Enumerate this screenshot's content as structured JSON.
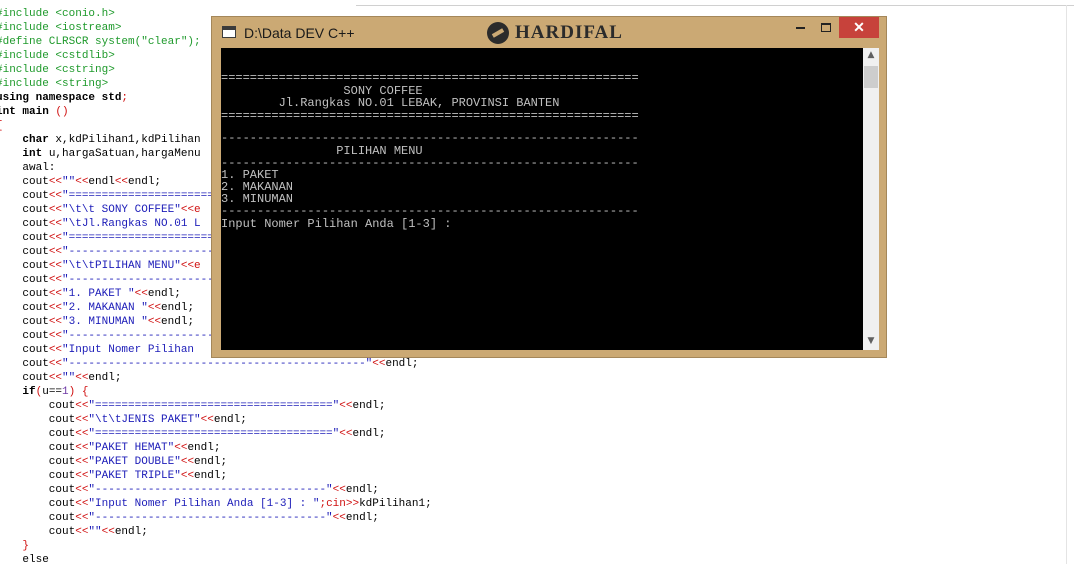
{
  "editor": {
    "lines": [
      [
        {
          "t": "#include <conio.h>",
          "c": "pp"
        }
      ],
      [
        {
          "t": "#include <iostream>",
          "c": "pp"
        }
      ],
      [
        {
          "t": "#define CLRSCR system(\"clear\");",
          "c": "pp"
        }
      ],
      [
        {
          "t": "#include <cstdlib>",
          "c": "pp"
        }
      ],
      [
        {
          "t": "#include <cstring>",
          "c": "pp"
        }
      ],
      [
        {
          "t": "#include <string>",
          "c": "pp"
        }
      ],
      [
        {
          "t": "using namespace std",
          "c": "kw"
        },
        {
          "t": ";",
          "c": "op"
        }
      ],
      [
        {
          "t": "int main ",
          "c": "kw"
        },
        {
          "t": "()",
          "c": "op"
        }
      ],
      [
        {
          "t": "{",
          "c": "op"
        }
      ],
      [
        {
          "t": "    "
        },
        {
          "t": "char",
          "c": "kw"
        },
        {
          "t": " x,kdPilihan1,kdPilihan"
        }
      ],
      [
        {
          "t": "    "
        },
        {
          "t": "int",
          "c": "kw"
        },
        {
          "t": " u,hargaSatuan,hargaMenu"
        }
      ],
      [
        {
          "t": "    awal:"
        }
      ],
      [
        {
          "t": "    cout"
        },
        {
          "t": "<<",
          "c": "op"
        },
        {
          "t": "\"\"",
          "c": "st"
        },
        {
          "t": "<<",
          "c": "op"
        },
        {
          "t": "endl"
        },
        {
          "t": "<<",
          "c": "op"
        },
        {
          "t": "endl;"
        }
      ],
      [
        {
          "t": "    cout"
        },
        {
          "t": "<<",
          "c": "op"
        },
        {
          "t": "\"==============================",
          "c": "st"
        }
      ],
      [
        {
          "t": "    cout"
        },
        {
          "t": "<<",
          "c": "op"
        },
        {
          "t": "\"\\t\\t SONY COFFEE\"",
          "c": "st"
        },
        {
          "t": "<<e",
          "c": "op"
        }
      ],
      [
        {
          "t": "    cout"
        },
        {
          "t": "<<",
          "c": "op"
        },
        {
          "t": "\"\\tJl.Rangkas NO.01 L",
          "c": "st"
        }
      ],
      [
        {
          "t": "    cout"
        },
        {
          "t": "<<",
          "c": "op"
        },
        {
          "t": "\"==============================",
          "c": "st"
        }
      ],
      [
        {
          "t": "    cout"
        },
        {
          "t": "<<",
          "c": "op"
        },
        {
          "t": "\"------------------------------",
          "c": "st"
        }
      ],
      [
        {
          "t": "    cout"
        },
        {
          "t": "<<",
          "c": "op"
        },
        {
          "t": "\"\\t\\tPILIHAN MENU\"",
          "c": "st"
        },
        {
          "t": "<<e",
          "c": "op"
        }
      ],
      [
        {
          "t": "    cout"
        },
        {
          "t": "<<",
          "c": "op"
        },
        {
          "t": "\"------------------------------",
          "c": "st"
        }
      ],
      [
        {
          "t": "    cout"
        },
        {
          "t": "<<",
          "c": "op"
        },
        {
          "t": "\"1. PAKET \"",
          "c": "st"
        },
        {
          "t": "<<",
          "c": "op"
        },
        {
          "t": "endl;"
        }
      ],
      [
        {
          "t": "    cout"
        },
        {
          "t": "<<",
          "c": "op"
        },
        {
          "t": "\"2. MAKANAN \"",
          "c": "st"
        },
        {
          "t": "<<",
          "c": "op"
        },
        {
          "t": "endl;"
        }
      ],
      [
        {
          "t": "    cout"
        },
        {
          "t": "<<",
          "c": "op"
        },
        {
          "t": "\"3. MINUMAN \"",
          "c": "st"
        },
        {
          "t": "<<",
          "c": "op"
        },
        {
          "t": "endl;"
        }
      ],
      [
        {
          "t": "    cout"
        },
        {
          "t": "<<",
          "c": "op"
        },
        {
          "t": "\"------------------------------",
          "c": "st"
        }
      ],
      [
        {
          "t": "    cout"
        },
        {
          "t": "<<",
          "c": "op"
        },
        {
          "t": "\"Input Nomer Pilihan ",
          "c": "st"
        }
      ],
      [
        {
          "t": "    cout"
        },
        {
          "t": "<<",
          "c": "op"
        },
        {
          "t": "\"---------------------------------------------\"",
          "c": "st"
        },
        {
          "t": "<<",
          "c": "op"
        },
        {
          "t": "endl;"
        }
      ],
      [
        {
          "t": "    cout"
        },
        {
          "t": "<<",
          "c": "op"
        },
        {
          "t": "\"\"",
          "c": "st"
        },
        {
          "t": "<<",
          "c": "op"
        },
        {
          "t": "endl;"
        }
      ],
      [
        {
          "t": "    "
        },
        {
          "t": "if",
          "c": "kw"
        },
        {
          "t": "(",
          "c": "op"
        },
        {
          "t": "u=="
        },
        {
          "t": "1",
          "c": "nm"
        },
        {
          "t": ") {",
          "c": "op"
        }
      ],
      [
        {
          "t": "        cout"
        },
        {
          "t": "<<",
          "c": "op"
        },
        {
          "t": "\"====================================\"",
          "c": "st"
        },
        {
          "t": "<<",
          "c": "op"
        },
        {
          "t": "endl;"
        }
      ],
      [
        {
          "t": "        cout"
        },
        {
          "t": "<<",
          "c": "op"
        },
        {
          "t": "\"\\t\\tJENIS PAKET\"",
          "c": "st"
        },
        {
          "t": "<<",
          "c": "op"
        },
        {
          "t": "endl;"
        }
      ],
      [
        {
          "t": "        cout"
        },
        {
          "t": "<<",
          "c": "op"
        },
        {
          "t": "\"====================================\"",
          "c": "st"
        },
        {
          "t": "<<",
          "c": "op"
        },
        {
          "t": "endl;"
        }
      ],
      [
        {
          "t": "        cout"
        },
        {
          "t": "<<",
          "c": "op"
        },
        {
          "t": "\"PAKET HEMAT\"",
          "c": "st"
        },
        {
          "t": "<<",
          "c": "op"
        },
        {
          "t": "endl;"
        }
      ],
      [
        {
          "t": "        cout"
        },
        {
          "t": "<<",
          "c": "op"
        },
        {
          "t": "\"PAKET DOUBLE\"",
          "c": "st"
        },
        {
          "t": "<<",
          "c": "op"
        },
        {
          "t": "endl;"
        }
      ],
      [
        {
          "t": "        cout"
        },
        {
          "t": "<<",
          "c": "op"
        },
        {
          "t": "\"PAKET TRIPLE\"",
          "c": "st"
        },
        {
          "t": "<<",
          "c": "op"
        },
        {
          "t": "endl;"
        }
      ],
      [
        {
          "t": "        cout"
        },
        {
          "t": "<<",
          "c": "op"
        },
        {
          "t": "\"-----------------------------------\"",
          "c": "st"
        },
        {
          "t": "<<",
          "c": "op"
        },
        {
          "t": "endl;"
        }
      ],
      [
        {
          "t": "        cout"
        },
        {
          "t": "<<",
          "c": "op"
        },
        {
          "t": "\"Input Nomer Pilihan Anda [1-3] : \"",
          "c": "st"
        },
        {
          "t": ";cin>>",
          "c": "op"
        },
        {
          "t": "kdPilihan1;"
        }
      ],
      [
        {
          "t": "        cout"
        },
        {
          "t": "<<",
          "c": "op"
        },
        {
          "t": "\"-----------------------------------\"",
          "c": "st"
        },
        {
          "t": "<<",
          "c": "op"
        },
        {
          "t": "endl;"
        }
      ],
      [
        {
          "t": "        cout"
        },
        {
          "t": "<<",
          "c": "op"
        },
        {
          "t": "\"\"",
          "c": "st"
        },
        {
          "t": "<<",
          "c": "op"
        },
        {
          "t": "endl;"
        }
      ],
      [
        {
          "t": "    "
        },
        {
          "t": "}",
          "c": "op"
        }
      ],
      [
        {
          "t": "    else"
        }
      ]
    ]
  },
  "console": {
    "title": "D:\\Data DEV C++",
    "brand": "HARDIFAL",
    "close_label": "✕",
    "lines": [
      "==========================================================",
      "                 SONY COFFEE",
      "        Jl.Rangkas NO.01 LEBAK, PROVINSI BANTEN",
      "==========================================================",
      "----------------------------------------------------------",
      "                PILIHAN MENU",
      "----------------------------------------------------------",
      "1. PAKET",
      "2. MAKANAN",
      "3. MINUMAN",
      "----------------------------------------------------------",
      "Input Nomer Pilihan Anda [1-3] :"
    ],
    "colors": {
      "frame": "#cba974",
      "screen_bg": "#000000",
      "screen_text": "#c0c0c0",
      "close_bg": "#c7423b"
    }
  }
}
